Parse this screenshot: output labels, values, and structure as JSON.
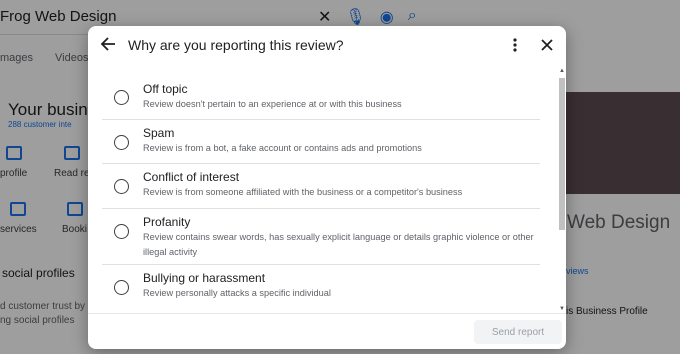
{
  "background": {
    "search_text": "Frog Web Design",
    "tabs": [
      "mages",
      "Videos"
    ],
    "business_title": "Your busines",
    "customer_interactions": "288 customer inte",
    "actions": [
      "profile",
      "Read re",
      "services",
      "Booki"
    ],
    "social_heading": "social profiles",
    "trust_line1": "d customer trust by",
    "trust_line2": "ng social profiles",
    "right_name": "Web Design",
    "right_views": "views",
    "right_profile": "is Business Profile"
  },
  "dialog": {
    "title": "Why are you reporting this review?",
    "options": [
      {
        "label": "Off topic",
        "description": "Review doesn't pertain to an experience at or with this business"
      },
      {
        "label": "Spam",
        "description": "Review is from a bot, a fake account or contains ads and promotions"
      },
      {
        "label": "Conflict of interest",
        "description": "Review is from someone affiliated with the business or a competitor's business"
      },
      {
        "label": "Profanity",
        "description": "Review contains swear words, has sexually explicit language or details graphic violence or other illegal activity"
      },
      {
        "label": "Bullying or harassment",
        "description": "Review personally attacks a specific individual"
      }
    ],
    "send_label": "Send report"
  },
  "icons": {
    "back": "arrow-left-icon",
    "more": "more-vert-icon",
    "close": "close-icon"
  }
}
